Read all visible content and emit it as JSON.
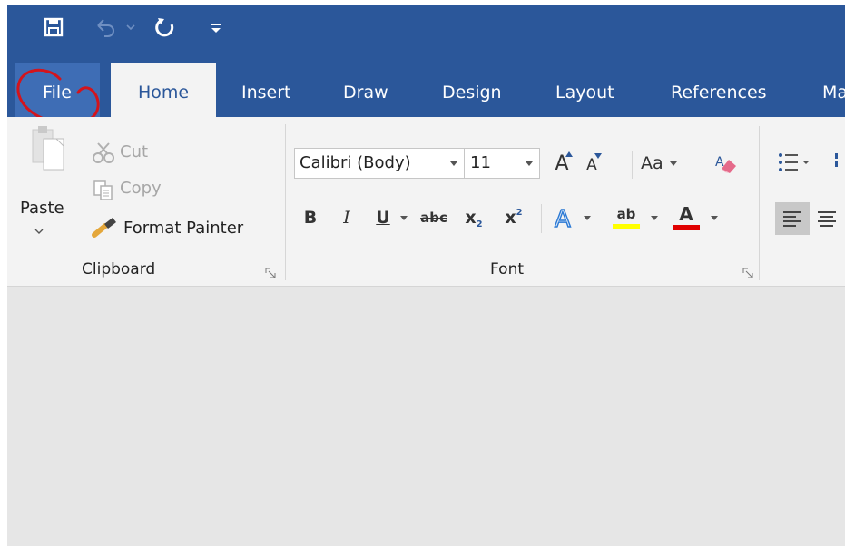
{
  "window": {
    "accent": "#2b579a",
    "ribbon_bg": "#f3f3f3",
    "doc_bg": "#e6e6e6"
  },
  "qat": {
    "save_icon": "save-icon",
    "undo_icon": "undo-icon",
    "redo_icon": "redo-icon",
    "customize_icon": "customize-qat-icon"
  },
  "tabs": [
    "File",
    "Home",
    "Insert",
    "Draw",
    "Design",
    "Layout",
    "References",
    "Ma"
  ],
  "clipboard": {
    "paste_label": "Paste",
    "cut_label": "Cut",
    "copy_label": "Copy",
    "format_painter_label": "Format Painter",
    "group_label": "Clipboard"
  },
  "font": {
    "font_name": "Calibri (Body)",
    "font_size": "11",
    "change_case_label": "Aa",
    "bold": "B",
    "italic": "I",
    "underline": "U",
    "strikethrough": "abc",
    "subscript_base": "x",
    "subscript_mark": "2",
    "superscript_base": "x",
    "superscript_mark": "2",
    "highlight_letters": "ab",
    "font_color_letter": "A",
    "highlight_color": "#ffff00",
    "font_color": "#e00000",
    "grow_letter": "A",
    "shrink_letter": "A",
    "group_label": "Font"
  },
  "annotation": {
    "color": "#d3141c"
  }
}
